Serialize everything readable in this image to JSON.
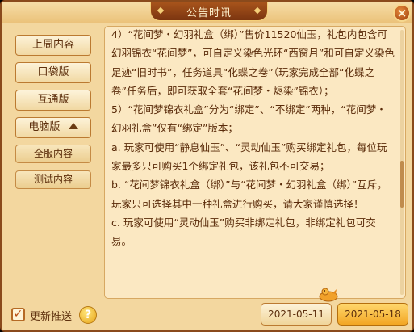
{
  "window": {
    "title": "公告时讯",
    "close_symbol": "×"
  },
  "sidebar": {
    "items": [
      {
        "label": "上周内容"
      },
      {
        "label": "口袋版"
      },
      {
        "label": "互通版"
      },
      {
        "label": "电脑版"
      }
    ],
    "subitems": [
      {
        "label": "全服内容"
      },
      {
        "label": "测试内容"
      }
    ]
  },
  "content": {
    "paragraphs": [
      "4）“花间梦・幻羽礼盒（绑）”售价11520仙玉，礼包内包含可幻羽锦衣“花间梦”，可自定义染色光环“西窗月”和可自定义染色足迹“旧时书”，任务道具“化蝶之卷”（玩家完成全部“化蝶之卷”任务后，即可获取全套“花间梦・烬染”锦衣）；",
      "5）“花间梦锦衣礼盒”分为“绑定”、“不绑定”两种，“花间梦・幻羽礼盒”仅有“绑定”版本；",
      "a. 玩家可使用“静息仙玉”、“灵动仙玉”购买绑定礼包，每位玩家最多只可购买1个绑定礼包，该礼包不可交易；",
      "b. “花间梦锦衣礼盒（绑）”与“花间梦・幻羽礼盒（绑）”互斥，玩家只可选择其中一种礼盒进行购买，请大家谨慎选择！",
      "c. 玩家可使用“灵动仙玉”购买非绑定礼包，非绑定礼包可交易。"
    ]
  },
  "footer": {
    "push_label": "更新推送",
    "push_checked": true,
    "help_symbol": "?",
    "dates": [
      "2021-05-11",
      "2021-05-18"
    ],
    "selected_date": "2021-05-18"
  },
  "icons": {
    "close": "close-icon",
    "help": "help-icon",
    "checkbox": "checkmark-icon",
    "collapse": "caret-up-icon",
    "mascot": "mascot-icon"
  },
  "colors": {
    "panel": "#f3d79f",
    "text": "#5a2b0a",
    "title_plaque": "#9b4a17",
    "active_tab": "#f2a624"
  }
}
